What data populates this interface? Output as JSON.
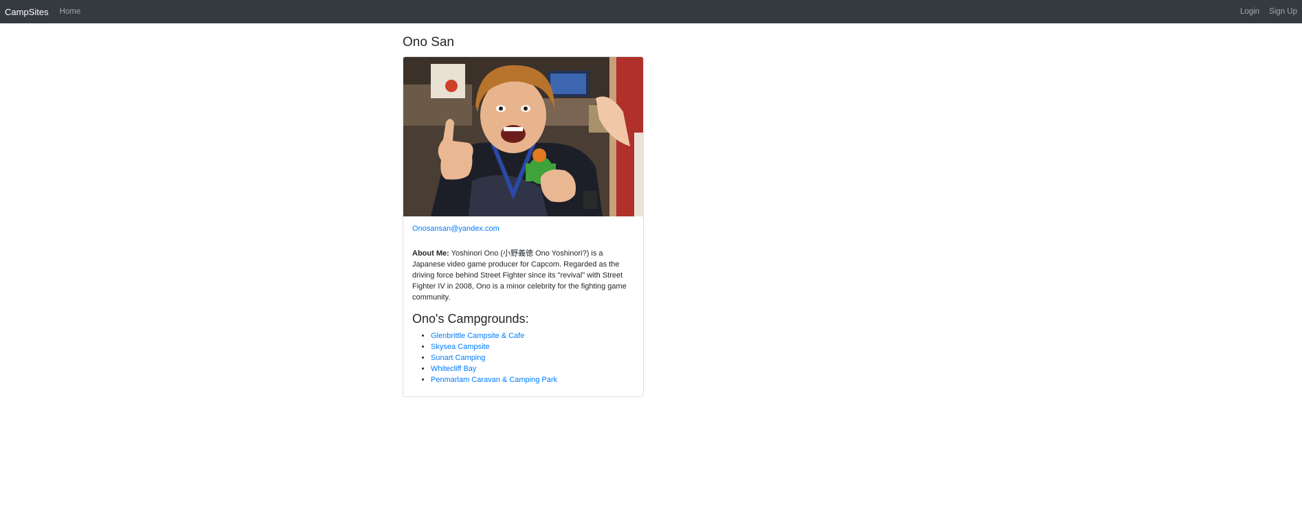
{
  "navbar": {
    "brand": "CampSites",
    "home": "Home",
    "login": "Login",
    "signup": "Sign Up"
  },
  "profile": {
    "name": "Ono San",
    "email": "Onosansan@yandex.com",
    "about_label": "About Me:",
    "about_text": "Yoshinori Ono (小野義徳 Ono Yoshinori?) is a Japanese video game producer for Capcom. Regarded as the driving force behind Street Fighter since its \"revival\" with Street Fighter IV in 2008, Ono is a minor celebrity for the fighting game community.",
    "campgrounds_title": "Ono's Campgrounds:",
    "campgrounds": [
      "Glenbrittle Campsite & Cafe",
      "Skysea Campsite",
      "Sunart Camping",
      "Whitecliff Bay",
      "Penmarlam Caravan & Camping Park"
    ]
  },
  "colors": {
    "navbar_bg": "#343a40",
    "link": "#007bff"
  }
}
